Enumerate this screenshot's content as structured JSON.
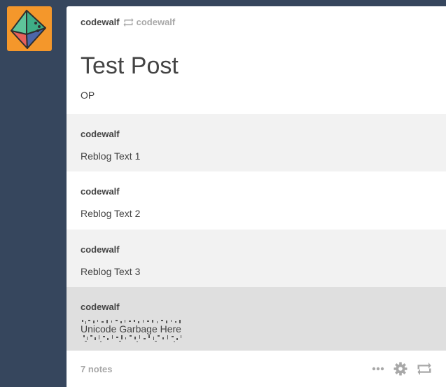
{
  "post": {
    "header": {
      "author": "codewalf",
      "source": "codewalf",
      "icon": "reblog-icon"
    },
    "title": "Test Post",
    "body": "OP",
    "trail": [
      {
        "author": "codewalf",
        "text": "Reblog Text 1"
      },
      {
        "author": "codewalf",
        "text": "Reblog Text 2"
      },
      {
        "author": "codewalf",
        "text": "Reblog Text 3"
      },
      {
        "author": "codewalf",
        "text": "Unicode Garbage Here"
      }
    ],
    "footer": {
      "notes": "7 notes",
      "controls": [
        "more-icon",
        "gear-icon",
        "reblog-icon"
      ]
    }
  },
  "colors": {
    "background": "#36465d",
    "avatar_bg": "#f4972b",
    "text": "#444444",
    "muted": "#a8a8a8",
    "trail_shade": "#f2f2f2",
    "highlight_shade": "#dfdfdf"
  }
}
